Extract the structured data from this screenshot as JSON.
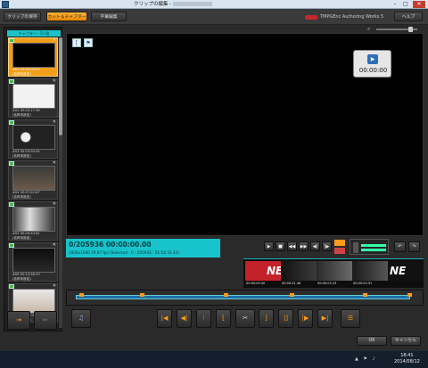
{
  "window": {
    "title": "クリップの編集 -"
  },
  "tabs": [
    {
      "label": "クリップの保存"
    },
    {
      "label": "カット＆チャプター"
    },
    {
      "label": "字幕編集"
    }
  ],
  "brand": {
    "label": "TMPGEnc Authoring Works 5"
  },
  "help_label": "ヘルプ",
  "chapter_panel": {
    "header": "チャプター : 15 個",
    "items": [
      {
        "index": "#01",
        "timecode": "00:00:00.00",
        "name": "(名称未設定)"
      },
      {
        "index": "#02",
        "timecode": "00:03:17.96",
        "name": "(名称未設定)"
      },
      {
        "index": "#03",
        "timecode": "00:03:50.04",
        "name": "(名称未設定)"
      },
      {
        "index": "#04",
        "timecode": "00:07:42.87",
        "name": "(名称未設定)"
      },
      {
        "index": "#05",
        "timecode": "00:09:43.81",
        "name": "(名称未設定)"
      },
      {
        "index": "#06",
        "timecode": "00:13:58.39",
        "name": "(名称未設定)"
      },
      {
        "index": "#07",
        "timecode": "00:17:09.48",
        "name": "(名称未設定)"
      }
    ]
  },
  "preview": {
    "timecode": "00:00:00"
  },
  "info": {
    "frame_line": "0/205936  00:00:00.00",
    "sub_line": "1920x1080 29.97 fps  (Selected : 0 - 205935 : 01:54:31.43)"
  },
  "filmstrip": {
    "timecodes": [
      "00:00:00.00",
      "00:00:01.46",
      "00:00:03.23",
      "00:00:03.51"
    ],
    "logo_text": "NE"
  },
  "footer": {
    "ok_label": "OK",
    "cancel_label": "キャンセル"
  },
  "taskbar": {
    "time": "18:41",
    "date": "2014/08/12"
  },
  "colors": {
    "accent_orange": "#f29d18",
    "info_cyan": "#17c3cb",
    "timeline_blue": "#1e6fa8"
  }
}
